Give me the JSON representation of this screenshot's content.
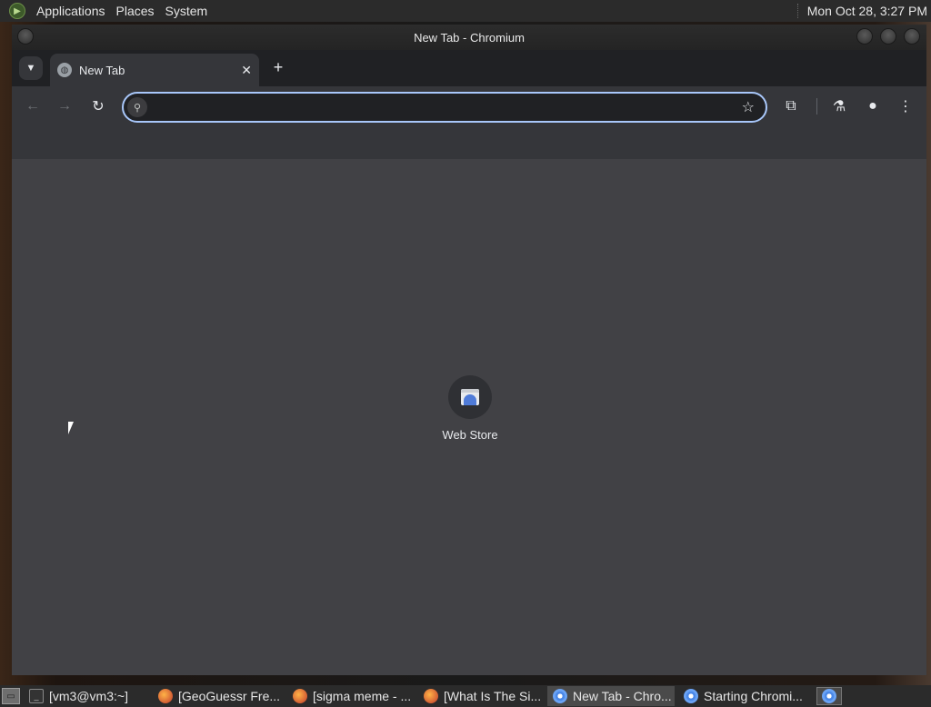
{
  "top_panel": {
    "menus": [
      "Applications",
      "Places",
      "System"
    ],
    "clock": "Mon Oct 28,  3:27 PM"
  },
  "window": {
    "title": "New Tab - Chromium"
  },
  "tabs": [
    {
      "title": "New Tab",
      "close": "✕"
    }
  ],
  "tabstrip": {
    "tab_search_icon": "chevron-down-icon",
    "new_tab_glyph": "+"
  },
  "toolbar": {
    "back_glyph": "←",
    "forward_glyph": "→",
    "reload_glyph": "↻",
    "omnibox_value": "",
    "omnibox_placeholder": "",
    "star_glyph": "☆",
    "extensions_glyph": "⧉",
    "labs_glyph": "⚗",
    "profile_glyph": "●",
    "menu_glyph": "⋮"
  },
  "new_tab_page": {
    "shortcuts": [
      {
        "label": "Web Store",
        "icon": "web-store-icon"
      }
    ]
  },
  "taskbar": {
    "items": [
      {
        "label": "[vm3@vm3:~]",
        "icon": "terminal",
        "active": false
      },
      {
        "label": "[GeoGuessr Fre...",
        "icon": "firefox",
        "active": false
      },
      {
        "label": "[sigma meme - ...",
        "icon": "firefox",
        "active": false
      },
      {
        "label": "[What Is The Si...",
        "icon": "firefox",
        "active": false
      },
      {
        "label": "New Tab - Chro...",
        "icon": "chromium",
        "active": true
      },
      {
        "label": "Starting Chromi...",
        "icon": "chromium",
        "active": false
      }
    ]
  },
  "colors": {
    "omnibox_focus": "#a8c7fa",
    "content_bg": "#414145",
    "toolbar_bg": "#35363a"
  }
}
